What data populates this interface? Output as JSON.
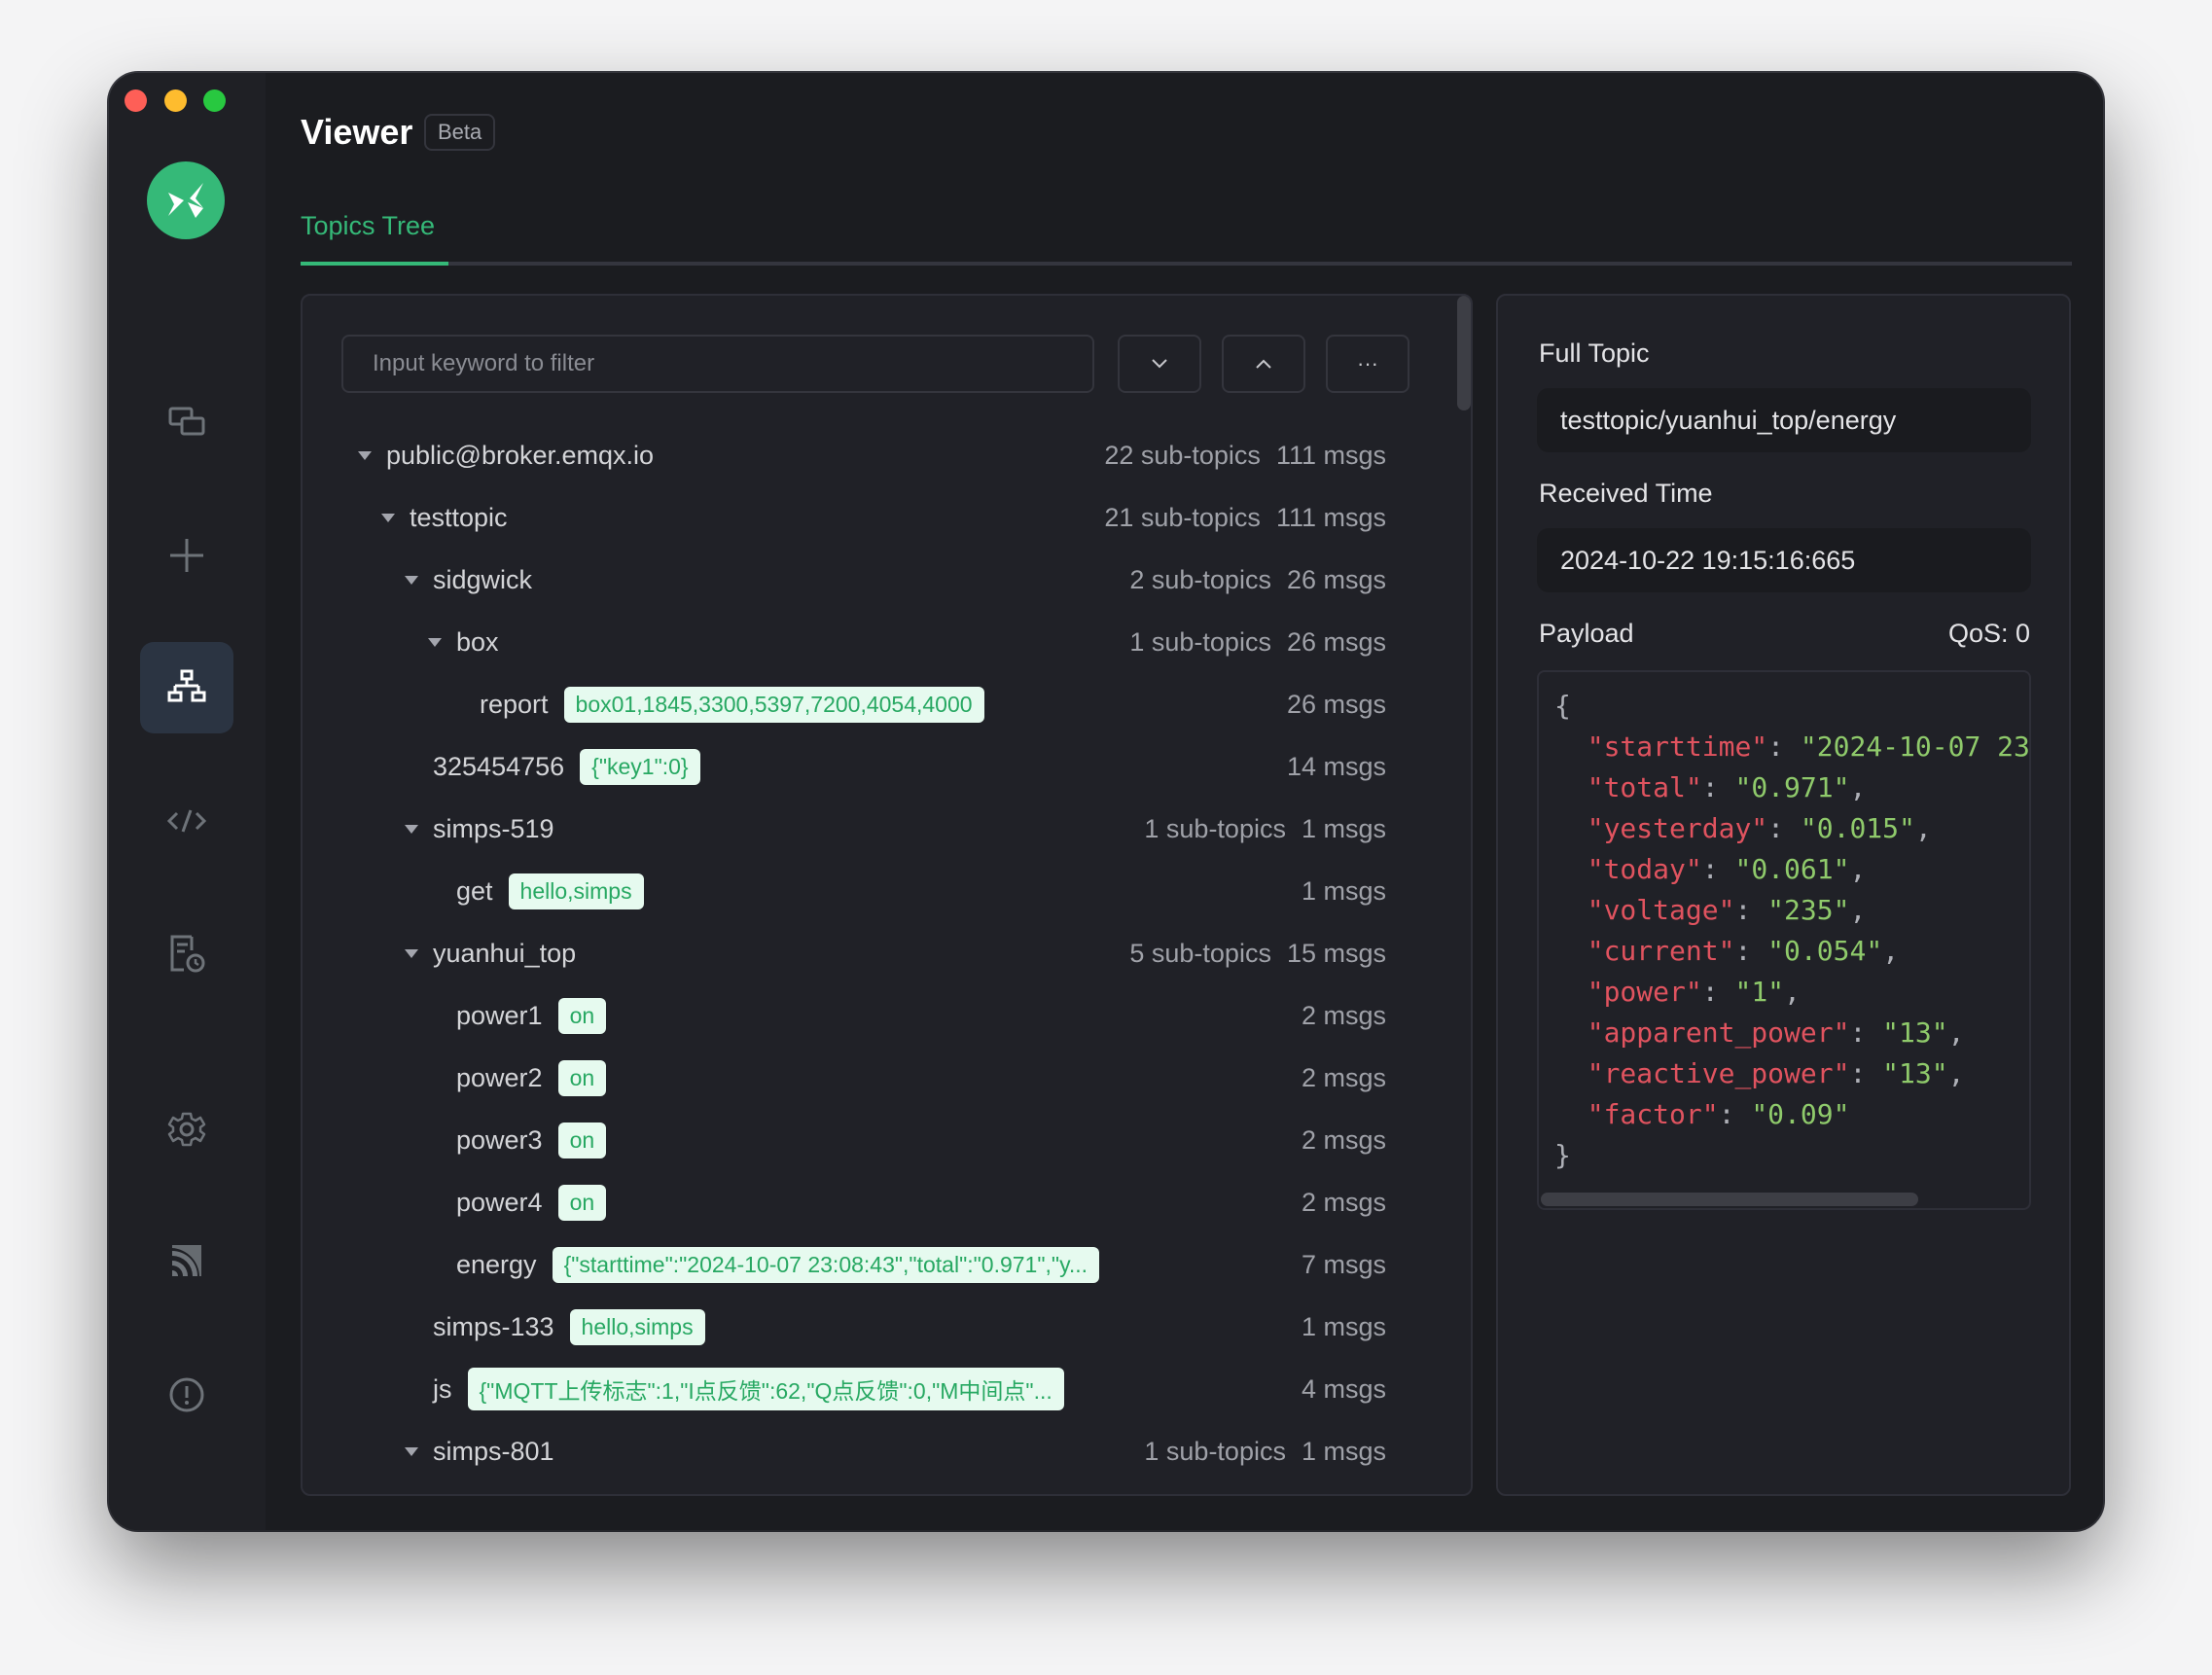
{
  "window": {
    "traffic_lights": [
      "close",
      "minimize",
      "maximize"
    ]
  },
  "sidebar": {
    "logo": "mqttx-logo",
    "items": [
      {
        "name": "connections",
        "icon": "connections-icon",
        "active": false
      },
      {
        "name": "new-connection",
        "icon": "plus-icon",
        "active": false
      },
      {
        "name": "viewer",
        "icon": "topics-tree-icon",
        "active": true
      },
      {
        "name": "script",
        "icon": "code-icon",
        "active": false
      },
      {
        "name": "log",
        "icon": "log-icon",
        "active": false
      },
      {
        "name": "settings",
        "icon": "gear-icon",
        "active": false
      },
      {
        "name": "subscriptions",
        "icon": "feed-icon",
        "active": false
      },
      {
        "name": "about",
        "icon": "info-icon",
        "active": false
      }
    ]
  },
  "header": {
    "title": "Viewer",
    "badge": "Beta",
    "accent_color": "#35b978"
  },
  "tabs": [
    {
      "label": "Topics Tree",
      "active": true
    }
  ],
  "tree_panel": {
    "filter_placeholder": "Input keyword to filter",
    "filter_value": "",
    "buttons": {
      "collapse_all": "chevron-down",
      "expand_all": "chevron-up",
      "more": "···"
    },
    "rows": [
      {
        "level": 0,
        "expanded": true,
        "name": "public@broker.emqx.io",
        "payload": null,
        "sub_topics": "22 sub-topics",
        "msgs": "111 msgs"
      },
      {
        "level": 1,
        "expanded": true,
        "name": "testtopic",
        "payload": null,
        "sub_topics": "21 sub-topics",
        "msgs": "111 msgs"
      },
      {
        "level": 2,
        "expanded": true,
        "name": "sidgwick",
        "payload": null,
        "sub_topics": "2 sub-topics",
        "msgs": "26 msgs"
      },
      {
        "level": 3,
        "expanded": true,
        "name": "box",
        "payload": null,
        "sub_topics": "1 sub-topics",
        "msgs": "26 msgs"
      },
      {
        "level": 4,
        "expanded": null,
        "name": "report",
        "payload": "box01,1845,3300,5397,7200,4054,4000",
        "sub_topics": null,
        "msgs": "26 msgs"
      },
      {
        "level": 2,
        "expanded": null,
        "name": "325454756",
        "payload": "{\"key1\":0}",
        "sub_topics": null,
        "msgs": "14 msgs"
      },
      {
        "level": 2,
        "expanded": true,
        "name": "simps-519",
        "payload": null,
        "sub_topics": "1 sub-topics",
        "msgs": "1 msgs"
      },
      {
        "level": 3,
        "expanded": null,
        "name": "get",
        "payload": "hello,simps",
        "sub_topics": null,
        "msgs": "1 msgs"
      },
      {
        "level": 2,
        "expanded": true,
        "name": "yuanhui_top",
        "payload": null,
        "sub_topics": "5 sub-topics",
        "msgs": "15 msgs"
      },
      {
        "level": 3,
        "expanded": null,
        "name": "power1",
        "payload": "on",
        "sub_topics": null,
        "msgs": "2 msgs"
      },
      {
        "level": 3,
        "expanded": null,
        "name": "power2",
        "payload": "on",
        "sub_topics": null,
        "msgs": "2 msgs"
      },
      {
        "level": 3,
        "expanded": null,
        "name": "power3",
        "payload": "on",
        "sub_topics": null,
        "msgs": "2 msgs"
      },
      {
        "level": 3,
        "expanded": null,
        "name": "power4",
        "payload": "on",
        "sub_topics": null,
        "msgs": "2 msgs"
      },
      {
        "level": 3,
        "expanded": null,
        "name": "energy",
        "payload": "{\"starttime\":\"2024-10-07 23:08:43\",\"total\":\"0.971\",\"y...",
        "sub_topics": null,
        "msgs": "7 msgs"
      },
      {
        "level": 2,
        "expanded": null,
        "name": "simps-133",
        "payload": "hello,simps",
        "sub_topics": null,
        "msgs": "1 msgs"
      },
      {
        "level": 2,
        "expanded": null,
        "name": "js",
        "payload": "{\"MQTT上传标志\":1,\"I点反馈\":62,\"Q点反馈\":0,\"M中间点\"...",
        "sub_topics": null,
        "msgs": "4 msgs"
      },
      {
        "level": 2,
        "expanded": true,
        "name": "simps-801",
        "payload": null,
        "sub_topics": "1 sub-topics",
        "msgs": "1 msgs"
      }
    ]
  },
  "detail_panel": {
    "full_topic_label": "Full Topic",
    "full_topic_value": "testtopic/yuanhui_top/energy",
    "received_time_label": "Received Time",
    "received_time_value": "2024-10-22 19:15:16:665",
    "payload_label": "Payload",
    "qos_label": "QoS: 0",
    "payload_lines": [
      {
        "key": null,
        "value": null,
        "text": "{"
      },
      {
        "key": "starttime",
        "value": "2024-10-07 23",
        "comma": false
      },
      {
        "key": "total",
        "value": "0.971",
        "comma": true
      },
      {
        "key": "yesterday",
        "value": "0.015",
        "comma": true
      },
      {
        "key": "today",
        "value": "0.061",
        "comma": true
      },
      {
        "key": "voltage",
        "value": "235",
        "comma": true
      },
      {
        "key": "current",
        "value": "0.054",
        "comma": true
      },
      {
        "key": "power",
        "value": "1",
        "comma": true
      },
      {
        "key": "apparent_power",
        "value": "13",
        "comma": true
      },
      {
        "key": "reactive_power",
        "value": "13",
        "comma": true
      },
      {
        "key": "factor",
        "value": "0.09",
        "comma": false
      },
      {
        "key": null,
        "value": null,
        "text": "}"
      }
    ],
    "key_color": "#e0535f",
    "string_color": "#8fca6b"
  }
}
